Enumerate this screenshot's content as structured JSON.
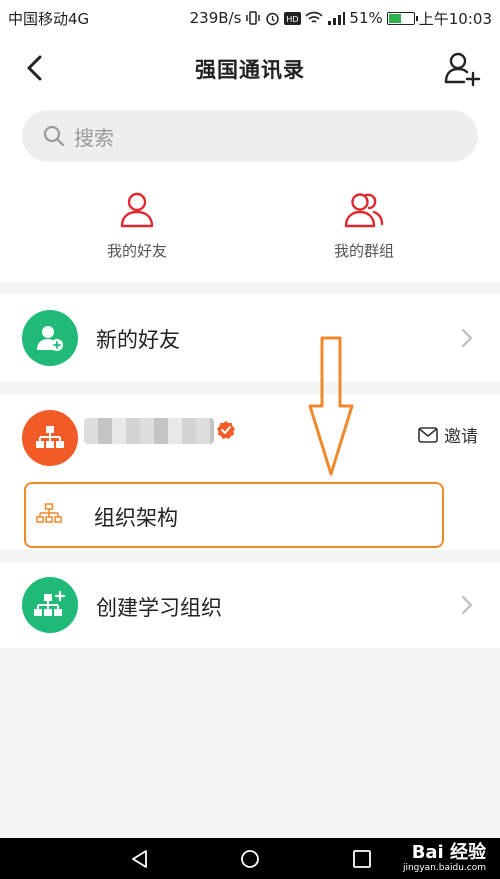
{
  "status_bar": {
    "carrier": "中国移动4G",
    "speed": "239B/s",
    "battery": "51%",
    "battery_level": 0.51,
    "time": "上午10:03"
  },
  "nav": {
    "title": "强国通讯录"
  },
  "search": {
    "placeholder": "搜索"
  },
  "quick": {
    "friends_label": "我的好友",
    "groups_label": "我的群组"
  },
  "list": {
    "new_friends_label": "新的好友",
    "org_invite_label": "邀请",
    "org_structure_label": "组织架构",
    "create_org_label": "创建学习组织"
  },
  "watermark": {
    "brand": "Bai 经验",
    "url": "jingyan.baidu.com"
  },
  "colors": {
    "green": "#1fb978",
    "orange": "#f25a26",
    "red": "#e0292f",
    "highlight": "#f0892c"
  }
}
